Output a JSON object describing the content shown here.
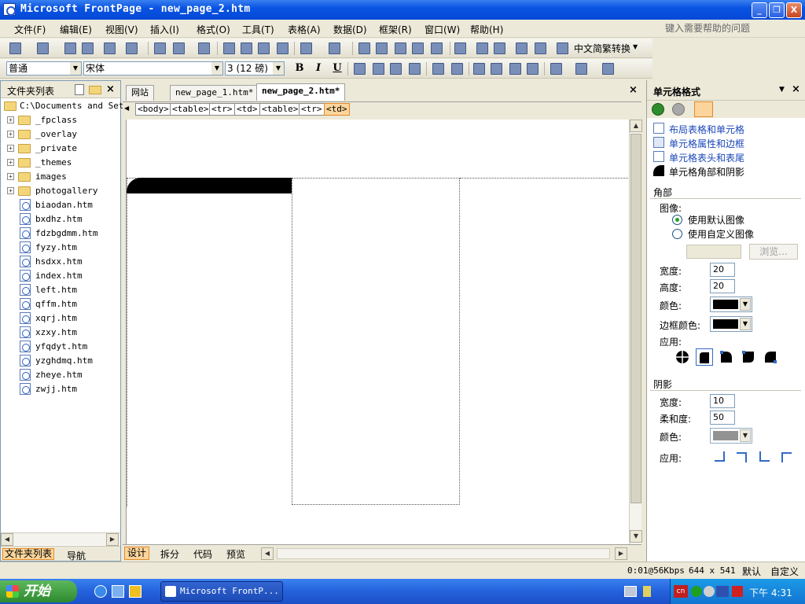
{
  "window": {
    "title": "Microsoft FrontPage - new_page_2.htm",
    "min_label": "_",
    "max_label": "❐",
    "close_label": "X"
  },
  "menu": [
    {
      "label": "文件(F)"
    },
    {
      "label": "编辑(E)"
    },
    {
      "label": "视图(V)"
    },
    {
      "label": "插入(I)"
    },
    {
      "label": "格式(O)"
    },
    {
      "label": "工具(T)"
    },
    {
      "label": "表格(A)"
    },
    {
      "label": "数据(D)"
    },
    {
      "label": "框架(R)"
    },
    {
      "label": "窗口(W)"
    },
    {
      "label": "帮助(H)"
    }
  ],
  "help_placeholder": "键入需要帮助的问题",
  "toolbar": {
    "convert_label": "中文简繁转换",
    "style_value": "普通",
    "font_value": "宋体",
    "size_value": "3 (12 磅)",
    "bold": "B",
    "italic": "I",
    "underline": "U"
  },
  "left_panel": {
    "title": "文件夹列表",
    "root": "C:\\Documents and Sett",
    "folders": [
      "_fpclass",
      "_overlay",
      "_private",
      "_themes",
      "images",
      "photogallery"
    ],
    "files": [
      "biaodan.htm",
      "bxdhz.htm",
      "fdzbgdmm.htm",
      "fyzy.htm",
      "hsdxx.htm",
      "index.htm",
      "left.htm",
      "qffm.htm",
      "xqrj.htm",
      "xzxy.htm",
      "yfqdyt.htm",
      "yzghdmq.htm",
      "zheye.htm",
      "zwjj.htm"
    ],
    "tab_folders": "文件夹列表",
    "tab_nav": "导航"
  },
  "editor": {
    "tabs": [
      "网站",
      "new_page_1.htm*",
      "new_page_2.htm*"
    ],
    "active_tab": 2,
    "tags": [
      "<body>",
      "<table>",
      "<tr>",
      "<td>",
      "<table>",
      "<tr>",
      "<td>"
    ],
    "views": [
      "设计",
      "拆分",
      "代码",
      "预览"
    ]
  },
  "right_panel": {
    "title": "单元格格式",
    "links": [
      "布局表格和单元格",
      "单元格属性和边框",
      "单元格表头和表尾",
      "单元格角部和阴影"
    ],
    "corner": {
      "heading": "角部",
      "image_label": "图像:",
      "radio_default": "使用默认图像",
      "radio_custom": "使用自定义图像",
      "browse": "浏览...",
      "width_label": "宽度:",
      "width_value": "20",
      "height_label": "高度:",
      "height_value": "20",
      "color_label": "颜色:",
      "border_color_label": "边框颜色:",
      "apply_label": "应用:",
      "color": "#000000",
      "border_color": "#000000"
    },
    "shadow": {
      "heading": "阴影",
      "width_label": "宽度:",
      "width_value": "10",
      "softness_label": "柔和度:",
      "softness_value": "50",
      "color_label": "颜色:",
      "apply_label": "应用:",
      "color": "#808080"
    }
  },
  "status": {
    "time": "0:01@56Kbps",
    "size": "644 x 541",
    "mode1": "默认",
    "mode2": "自定义"
  },
  "taskbar": {
    "start": "开始",
    "task": "Microsoft FrontP...",
    "clock": "下午 4:31"
  }
}
